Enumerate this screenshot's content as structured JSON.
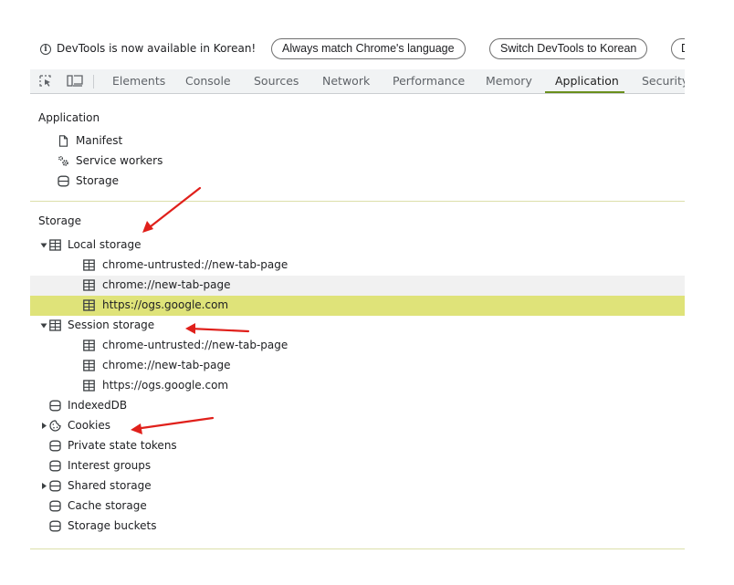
{
  "infobar": {
    "message": "DevTools is now available in Korean!",
    "btn_match": "Always match Chrome's language",
    "btn_switch": "Switch DevTools to Korean",
    "btn_dont": "D"
  },
  "tabs": [
    "Elements",
    "Console",
    "Sources",
    "Network",
    "Performance",
    "Memory",
    "Application",
    "Security"
  ],
  "active_tab": "Application",
  "application": {
    "title": "Application",
    "items": [
      "Manifest",
      "Service workers",
      "Storage"
    ]
  },
  "storage": {
    "title": "Storage",
    "local_storage": {
      "label": "Local storage",
      "children": [
        "chrome-untrusted://new-tab-page",
        "chrome://new-tab-page",
        "https://ogs.google.com"
      ]
    },
    "session_storage": {
      "label": "Session storage",
      "children": [
        "chrome-untrusted://new-tab-page",
        "chrome://new-tab-page",
        "https://ogs.google.com"
      ]
    },
    "indexeddb": "IndexedDB",
    "cookies": "Cookies",
    "private_state_tokens": "Private state tokens",
    "interest_groups": "Interest groups",
    "shared_storage": "Shared storage",
    "cache_storage": "Cache storage",
    "storage_buckets": "Storage buckets"
  },
  "colors": {
    "selected_row": "#dfe379",
    "active_tab_underline": "#6a8f1c",
    "annotation_arrow": "#e0201b"
  },
  "icons": [
    "info-icon",
    "inspect-element-icon",
    "device-toolbar-icon",
    "document-icon",
    "gears-icon",
    "database-icon",
    "table-icon",
    "cookie-icon",
    "expand-triangle-icon",
    "collapse-triangle-icon"
  ]
}
